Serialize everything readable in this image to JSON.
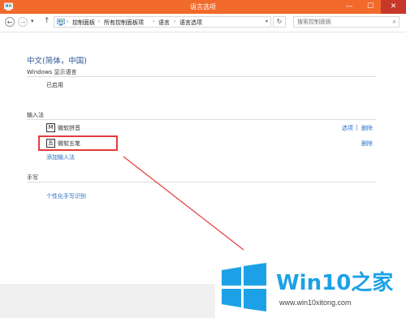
{
  "window": {
    "title": "语言选项",
    "minimize_glyph": "—",
    "maximize_glyph": "☐",
    "close_glyph": "✕"
  },
  "navbar": {
    "back_glyph": "←",
    "forward_glyph": "→",
    "recent_glyph": "▾",
    "up_glyph": "↑",
    "breadcrumbs": [
      "控制面板",
      "所有控制面板项",
      "语言",
      "语言选项"
    ],
    "separator_glyph": "›",
    "dropdown_glyph": "▾",
    "refresh_glyph": "↻",
    "search_placeholder": "搜索控制面板",
    "search_glyph": "⌕"
  },
  "language": {
    "name": "中文(简体，中国)",
    "display_language": {
      "label": "Windows 显示语言",
      "status": "已启用"
    },
    "input_methods": {
      "label": "输入法",
      "items": [
        {
          "icon_char": "M",
          "name": "微软拼音",
          "options_link": "选项",
          "divider": "|",
          "remove_link": "删除"
        },
        {
          "icon_char": "五",
          "name": "微软五笔",
          "remove_link": "删除"
        }
      ],
      "add_link": "添加输入法"
    },
    "handwriting": {
      "label": "手写",
      "link": "个性化手写识别"
    }
  },
  "watermark": {
    "brand": "Win10之家",
    "site": "www.win10xitong.com",
    "colors": {
      "tile": "#1da1e6",
      "text": "#1da1e6"
    }
  },
  "colors": {
    "titlebar": "#f26a2b",
    "close_button": "#c7372a",
    "heading": "#2b5797",
    "link": "#2a6fc4",
    "highlight": "#e53b3b"
  }
}
